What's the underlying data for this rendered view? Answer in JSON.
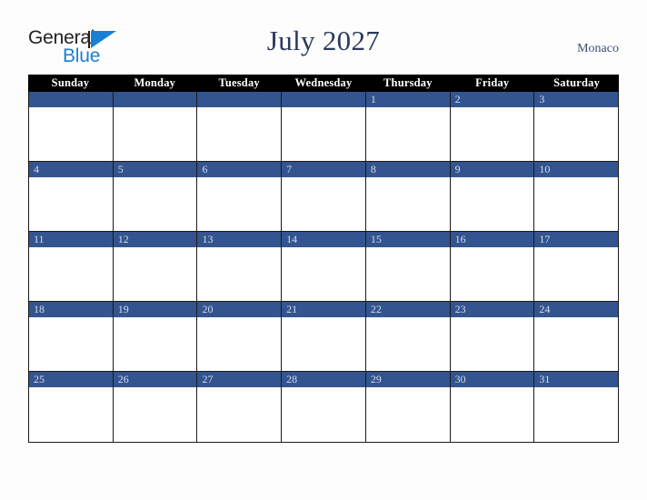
{
  "brand": {
    "name_part1": "General",
    "name_part2": "Blue",
    "triangle_icon": "blue-triangle-icon",
    "color_dark": "#231f20",
    "color_blue": "#1b7fd4"
  },
  "header": {
    "title": "July 2027",
    "location": "Monaco",
    "title_color": "#2b3a5c",
    "location_color": "#3c4e73"
  },
  "calendar": {
    "month": "July",
    "year": "2027",
    "header_background": "#000000",
    "header_text_color": "#ffffff",
    "daynum_background": "#33548f",
    "daynum_text_color": "#d6dcea",
    "cell_background": "#ffffff",
    "border_color": "#1a1a1a",
    "weekdays": [
      "Sunday",
      "Monday",
      "Tuesday",
      "Wednesday",
      "Thursday",
      "Friday",
      "Saturday"
    ],
    "weeks": [
      [
        "",
        "",
        "",
        "",
        "1",
        "2",
        "3"
      ],
      [
        "4",
        "5",
        "6",
        "7",
        "8",
        "9",
        "10"
      ],
      [
        "11",
        "12",
        "13",
        "14",
        "15",
        "16",
        "17"
      ],
      [
        "18",
        "19",
        "20",
        "21",
        "22",
        "23",
        "24"
      ],
      [
        "25",
        "26",
        "27",
        "28",
        "29",
        "30",
        "31"
      ]
    ]
  }
}
